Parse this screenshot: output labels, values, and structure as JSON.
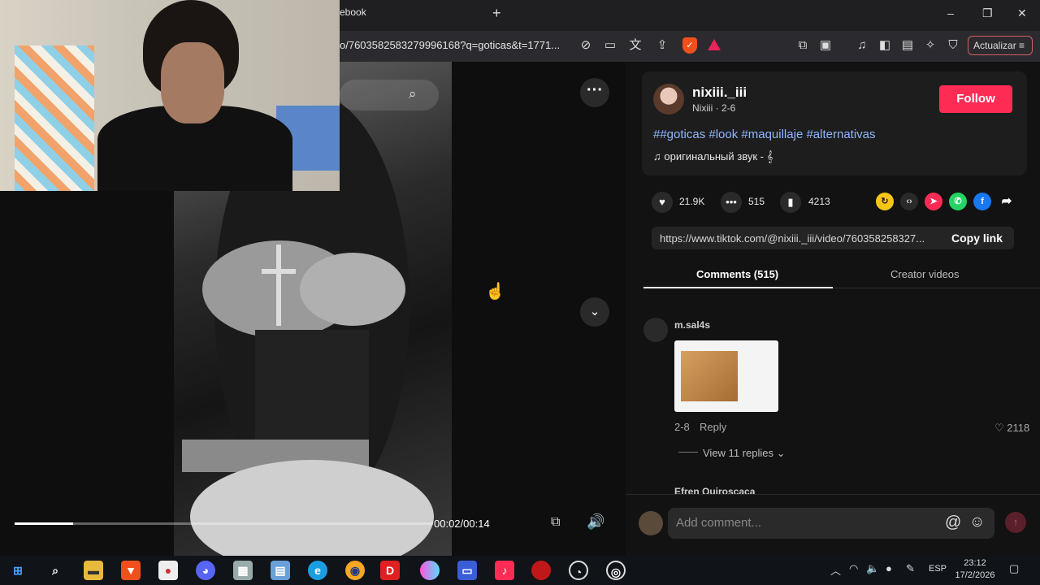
{
  "browser": {
    "tab_title": "ebook",
    "new_tab": "+",
    "url": "o/7603582583279996168?q=goticas&t=1771...",
    "update_button": "Actualizar",
    "window": {
      "minimize": "–",
      "maximize": "❐",
      "close": "✕"
    }
  },
  "video": {
    "time_display": "00:02/00:14",
    "progress_fraction": 0.14
  },
  "author": {
    "username": "nixiii._iii",
    "nickname_date": "Nixiii · 2-6",
    "follow_label": "Follow",
    "hashtags": "##goticas #look #maquillaje #alternativas",
    "sound": "оригинальный звук - 𝄞"
  },
  "stats": {
    "likes": "21.9K",
    "comments": "515",
    "saves": "4213"
  },
  "share": {
    "link": "https://www.tiktok.com/@nixiii._iii/video/760358258327...",
    "copy_label": "Copy link"
  },
  "tabs": {
    "comments": "Comments (515)",
    "creator": "Creator videos"
  },
  "comments": [
    {
      "user": "m.sal4s",
      "date": "2-8",
      "reply": "Reply",
      "likes": "2118",
      "view_replies": "View 11 replies"
    },
    {
      "user": "Efren Quiroscaca"
    }
  ],
  "comment_box": {
    "placeholder": "Add comment..."
  },
  "taskbar": {
    "lang": "ESP",
    "time": "23:12",
    "date": "17/2/2026"
  },
  "colors": {
    "follow": "#fe2c55",
    "hashtag": "#8fb8ff"
  }
}
